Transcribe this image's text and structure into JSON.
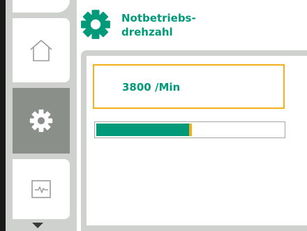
{
  "header": {
    "icon": "gear-icon",
    "title_line1": "Notbetriebs-",
    "title_line2": "drehzahl"
  },
  "nav": [
    {
      "icon": "home-icon",
      "selected": false
    },
    {
      "icon": "gear-icon",
      "selected": true
    },
    {
      "icon": "monitor-pulse-icon",
      "selected": false
    }
  ],
  "scroll_indicator": "chevron-down-icon",
  "setting": {
    "value": "3800 /Min",
    "level": 0.5
  },
  "colors": {
    "accent": "#00997a",
    "highlight": "#f2b11b",
    "rail": "#cfd1cf",
    "selected_nav": "#8a9089"
  }
}
